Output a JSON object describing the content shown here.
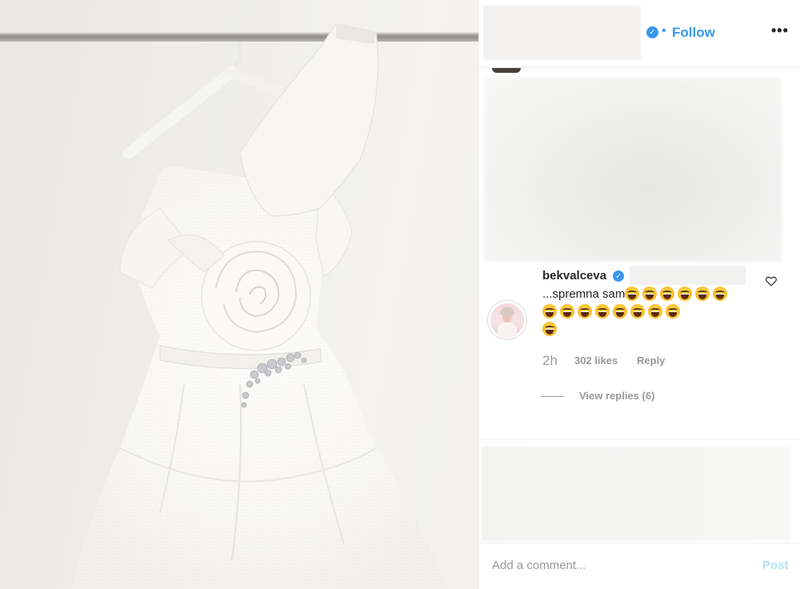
{
  "header": {
    "follow_label": "Follow",
    "separator": "•",
    "more_label": "•••",
    "verified_glyph": "✓"
  },
  "comment": {
    "username": "bekvalceva",
    "verified_glyph": "✓",
    "text": "...spremna sam",
    "emoji_name": "face-with-tears-of-joy",
    "emoji_rows": [
      6,
      8,
      1
    ],
    "time": "2h",
    "likes": "302 likes",
    "reply_label": "Reply",
    "view_replies": "View replies (6)"
  },
  "footer": {
    "add_comment_placeholder": "Add a comment...",
    "post_label": "Post"
  },
  "colors": {
    "accent": "#3897f0",
    "post_disabled": "#b2dffc",
    "muted_text": "#999999"
  },
  "icons": [
    "verified-badge-icon",
    "more-options-icon",
    "heart-icon"
  ]
}
